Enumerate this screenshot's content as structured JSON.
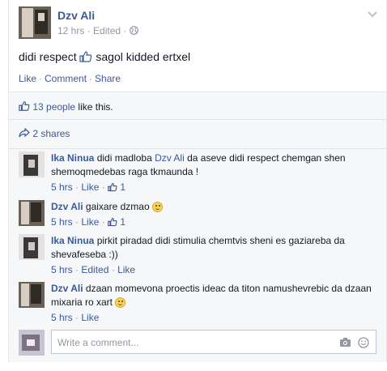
{
  "post": {
    "author": "Dzv Ali",
    "time": "12 hrs",
    "edited": "Edited",
    "meta_sep": "·",
    "text_before": "didi respect",
    "text_after": "sagol kidded ertxel",
    "actions": {
      "like": "Like",
      "comment": "Comment",
      "share": "Share",
      "sep": "·"
    }
  },
  "likes": {
    "people": "13 people",
    "suffix": "like this."
  },
  "shares": {
    "label": "2 shares"
  },
  "comments": [
    {
      "name": "Ika Ninua",
      "text_before": "didi madloba",
      "mention": "Dzv Ali",
      "text_after": "da aseve didi respect chemgan shen shemoqmedebas raga tkmaunda !",
      "time": "5 hrs",
      "like": "Like",
      "likes": "1"
    },
    {
      "name": "Dzv Ali",
      "text": "gaixare dzmao",
      "time": "5 hrs",
      "like": "Like",
      "likes": "1"
    },
    {
      "name": "Ika Ninua",
      "text": "pirkit piradad didi stimulia chemtvis sheni es gaziareba da shevafeseba :))",
      "time": "5 hrs",
      "edited": "Edited",
      "like": "Like"
    },
    {
      "name": "Dzv Ali",
      "text": "dzaan momevona proectis ideac da titon namushevrebic da dzaan mixaria ro xart",
      "time": "5 hrs",
      "like": "Like"
    }
  ],
  "composer": {
    "placeholder": "Write a comment..."
  },
  "colors": {
    "link": "#3b5998",
    "muted": "#9197a3",
    "ufi_bg": "#f6f7f9"
  },
  "icons": [
    "chevron-down-icon",
    "globe-icon",
    "thumbs-up-icon",
    "share-arrow-icon",
    "smiley-icon",
    "camera-icon"
  ]
}
